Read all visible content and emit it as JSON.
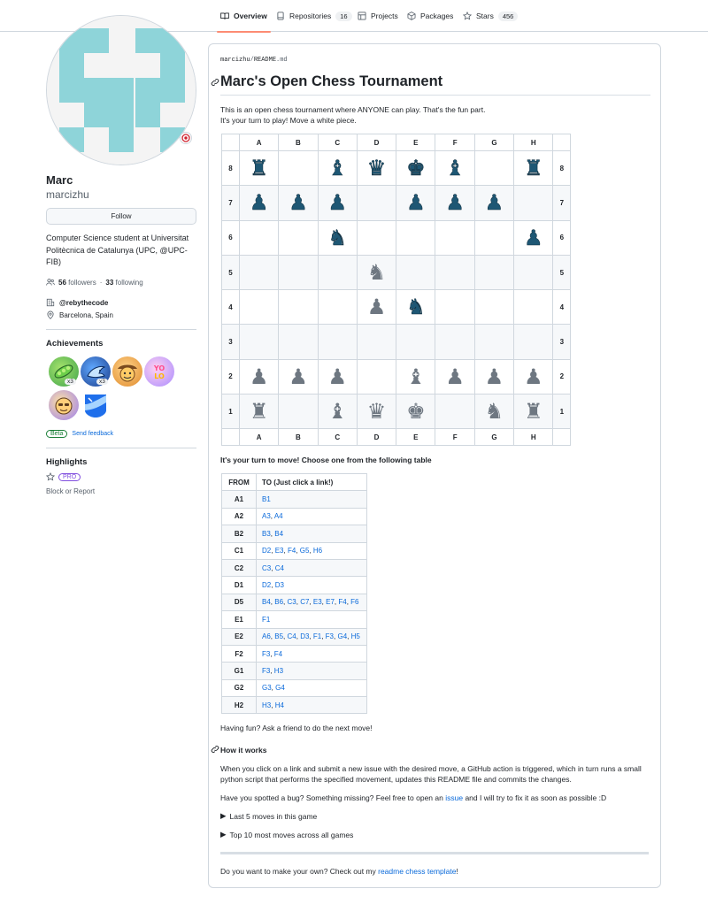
{
  "nav": {
    "tabs": [
      {
        "label": "Overview"
      },
      {
        "label": "Repositories",
        "count": "16"
      },
      {
        "label": "Projects"
      },
      {
        "label": "Packages"
      },
      {
        "label": "Stars",
        "count": "456"
      }
    ]
  },
  "profile": {
    "name": "Marc",
    "login": "marcizhu",
    "follow_label": "Follow",
    "bio": "Computer Science student at Universitat Politècnica de Catalunya (UPC, @UPC-FIB)",
    "followers_count": "56",
    "followers_label": "followers",
    "following_count": "33",
    "following_label": "following",
    "organization": "@rebythecode",
    "location": "Barcelona, Spain",
    "achievements_title": "Achievements",
    "achievement_counts": [
      "x3",
      "x3"
    ],
    "beta_label": "Beta",
    "feedback_label": "Send feedback",
    "highlights_title": "Highlights",
    "pro_label": "PRO",
    "block_label": "Block or Report"
  },
  "readme": {
    "path_user": "marcizhu",
    "path_sep": "/",
    "path_file": "README",
    "path_ext": ".md",
    "title": "Marc's Open Chess Tournament",
    "intro_1": "This is an open chess tournament where ANYONE can play. That's the fun part.",
    "intro_2": "It's your turn to play! Move a white piece.",
    "files": [
      "A",
      "B",
      "C",
      "D",
      "E",
      "F",
      "G",
      "H"
    ],
    "board": [
      {
        "rank": "8",
        "squares": [
          "br",
          "",
          "bb",
          "bq",
          "bk",
          "bb",
          "",
          "br"
        ]
      },
      {
        "rank": "7",
        "squares": [
          "bp",
          "bp",
          "bp",
          "",
          "bp",
          "bp",
          "bp",
          ""
        ]
      },
      {
        "rank": "6",
        "squares": [
          "",
          "",
          "bn",
          "",
          "",
          "",
          "",
          "bp"
        ]
      },
      {
        "rank": "5",
        "squares": [
          "",
          "",
          "",
          "wn",
          "",
          "",
          "",
          ""
        ]
      },
      {
        "rank": "4",
        "squares": [
          "",
          "",
          "",
          "wp",
          "bn",
          "",
          "",
          ""
        ]
      },
      {
        "rank": "3",
        "squares": [
          "",
          "",
          "",
          "",
          "",
          "",
          "",
          ""
        ]
      },
      {
        "rank": "2",
        "squares": [
          "wp",
          "wp",
          "wp",
          "",
          "wb",
          "wp",
          "wp",
          "wp"
        ]
      },
      {
        "rank": "1",
        "squares": [
          "wr",
          "",
          "wb",
          "wq",
          "wk",
          "",
          "wn",
          "wr"
        ]
      }
    ],
    "turn_heading": "It's your turn to move! Choose one from the following table",
    "moves_headers": [
      "FROM",
      "TO (Just click a link!)"
    ],
    "moves": [
      {
        "from": "A1",
        "to": [
          "B1"
        ]
      },
      {
        "from": "A2",
        "to": [
          "A3",
          "A4"
        ]
      },
      {
        "from": "B2",
        "to": [
          "B3",
          "B4"
        ]
      },
      {
        "from": "C1",
        "to": [
          "D2",
          "E3",
          "F4",
          "G5",
          "H6"
        ]
      },
      {
        "from": "C2",
        "to": [
          "C3",
          "C4"
        ]
      },
      {
        "from": "D1",
        "to": [
          "D2",
          "D3"
        ]
      },
      {
        "from": "D5",
        "to": [
          "B4",
          "B6",
          "C3",
          "C7",
          "E3",
          "E7",
          "F4",
          "F6"
        ]
      },
      {
        "from": "E1",
        "to": [
          "F1"
        ]
      },
      {
        "from": "E2",
        "to": [
          "A6",
          "B5",
          "C4",
          "D3",
          "F1",
          "F3",
          "G4",
          "H5"
        ]
      },
      {
        "from": "F2",
        "to": [
          "F3",
          "F4"
        ]
      },
      {
        "from": "G1",
        "to": [
          "F3",
          "H3"
        ]
      },
      {
        "from": "G2",
        "to": [
          "G3",
          "G4"
        ]
      },
      {
        "from": "H2",
        "to": [
          "H3",
          "H4"
        ]
      }
    ],
    "fun_text": "Having fun? Ask a friend to do the next move!",
    "how_title": "How it works",
    "how_text": "When you click on a link and submit a new issue with the desired move, a GitHub action is triggered, which in turn runs a small python script that performs the specified movement, updates this README file and commits the changes.",
    "bug_text_pre": "Have you spotted a bug? Something missing? Feel free to open an",
    "bug_link": "issue",
    "bug_text_post": "and I will try to fix it as soon as possible :D",
    "details_1": "Last 5 moves in this game",
    "details_2": "Top 10 most moves across all games",
    "footer_pre": "Do you want to make your own? Check out my",
    "footer_link": "readme chess template",
    "footer_post": "!"
  },
  "colors": {
    "avatar_tile": "#8ed4d9",
    "black_piece": "#1e5774",
    "link": "#0969da"
  }
}
